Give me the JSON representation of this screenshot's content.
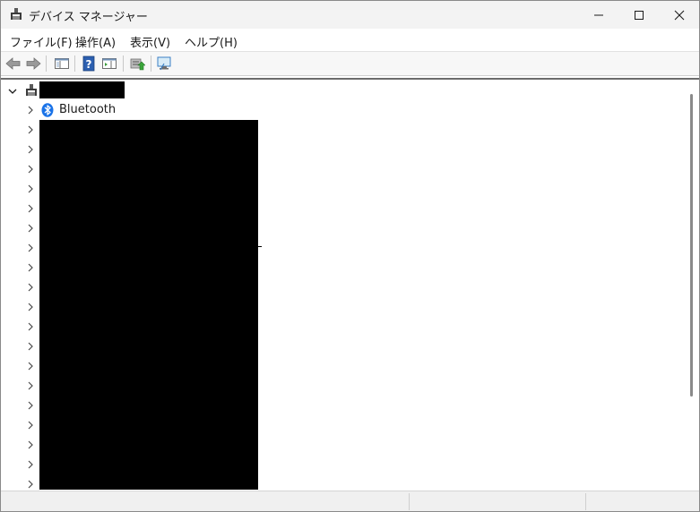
{
  "window": {
    "title": "デバイス マネージャー"
  },
  "menu": {
    "file": "ファイル(F)",
    "action": "操作(A)",
    "view": "表示(V)",
    "help": "ヘルプ(H)"
  },
  "toolbar": {
    "buttons": [
      "back-icon",
      "forward-icon",
      "show-hide-console-tree-icon",
      "help-icon",
      "properties-pane-icon",
      "update-driver-icon",
      "scan-hardware-icon"
    ]
  },
  "tree": {
    "root_expanded": true,
    "categories": [
      {
        "label": "Bluetooth",
        "icon": "bluetooth-icon"
      }
    ],
    "redacted_category_rows": 19
  },
  "colors": {
    "bluetooth_blue": "#1a73e8",
    "redaction": "#000000"
  }
}
